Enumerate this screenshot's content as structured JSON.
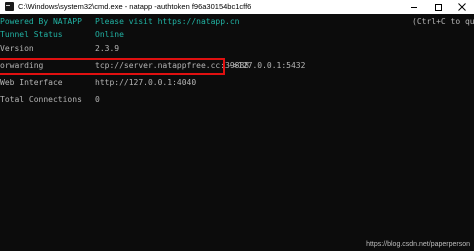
{
  "window": {
    "title": "C:\\Windows\\system32\\cmd.exe - natapp  -authtoken f96a30154bc1cff6",
    "icon": "cmd-icon"
  },
  "terminal": {
    "header_left": "Powered By NATAPP",
    "header_center": "Please visit https://natapp.cn",
    "header_right": "(Ctrl+C to quit)",
    "rows": [
      {
        "label": "Tunnel Status",
        "value": "Online"
      },
      {
        "label": "Version",
        "value": "2.3.9"
      },
      {
        "label": "orwarding",
        "value": "tcp://server.natappfree.cc:39888",
        "target": "127.0.0.1:5432"
      },
      {
        "label": "Web Interface",
        "value": "http://127.0.0.1:4040"
      },
      {
        "label": "Total Connections",
        "value": "0"
      }
    ]
  },
  "arrow_glyph": "->",
  "watermark": "https://blog.csdn.net/paperperson",
  "colors": {
    "background": "#0c0c0c",
    "teal": "#21b3a4",
    "text": "#b5b5b5",
    "highlight_box": "#e01010"
  }
}
